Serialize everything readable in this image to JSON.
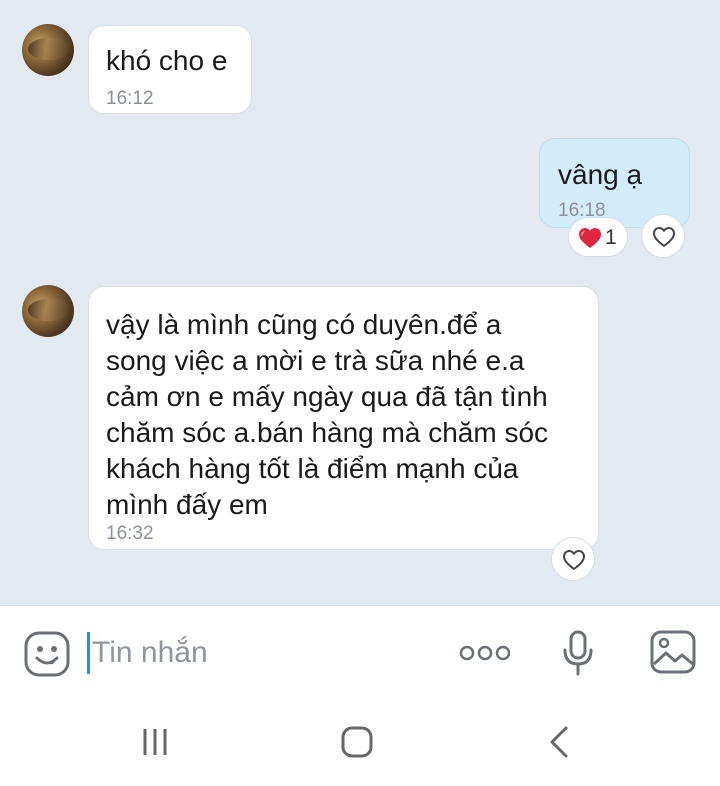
{
  "conversation": {
    "messages": [
      {
        "direction": "incoming",
        "text": "khó cho e",
        "time": "16:12"
      },
      {
        "direction": "outgoing",
        "text": "vâng ạ",
        "time": "16:18",
        "reaction": {
          "emoji": "heart",
          "count": "1"
        }
      },
      {
        "direction": "incoming",
        "text": "vậy là mình cũng có duyên.để a\nsong việc a mời e trà sữa nhé e.a\ncảm ơn e mấy ngày qua đã tận tình\nchăm sóc a.bán hàng mà chăm sóc\nkhách hàng tốt là điểm mạnh của\nmình đấy em",
        "time": "16:32"
      }
    ]
  },
  "composer": {
    "placeholder": "Tin nhắn",
    "icons": [
      "emoji-icon",
      "more-options-icon",
      "microphone-icon",
      "image-gallery-icon"
    ]
  },
  "navigation": {
    "icons": [
      "recent-apps-icon",
      "home-icon",
      "back-icon"
    ]
  },
  "colors": {
    "chat_background": "#e2e9f1",
    "incoming_bubble": "#ffffff",
    "outgoing_bubble": "#d3ecfb",
    "reaction_heart": "#e0253f",
    "caret": "#2a8fe0"
  }
}
